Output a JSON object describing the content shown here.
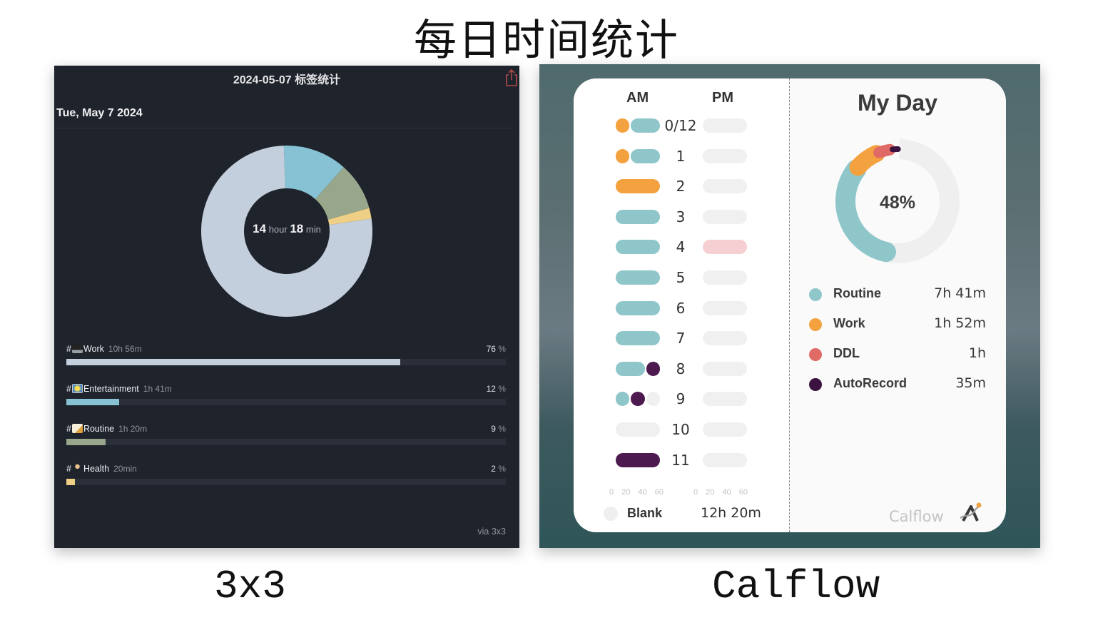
{
  "page_title": "每日时间统计",
  "captions": {
    "left": "3x3",
    "right": "Calflow"
  },
  "app_3x3": {
    "header_title": "2024-05-07 标签统计",
    "share_icon": "share-icon",
    "date_label": "Tue, May 7 2024",
    "total": {
      "hours": "14",
      "hour_unit": "hour",
      "minutes": "18",
      "minute_unit": "min"
    },
    "tags": [
      {
        "prefix": "#",
        "icon": "laptop-icon",
        "name": "Work",
        "duration": "10h 56m",
        "percent": "76",
        "percent_sign": "%",
        "fraction": 0.76,
        "color": "#c4cfdd"
      },
      {
        "prefix": "#",
        "icon": "sparkle-picture-icon",
        "name": "Entertainment",
        "duration": "1h 41m",
        "percent": "12",
        "percent_sign": "%",
        "fraction": 0.12,
        "color": "#86c2d3"
      },
      {
        "prefix": "#",
        "icon": "memo-icon",
        "name": "Routine",
        "duration": "1h 20m",
        "percent": "9",
        "percent_sign": "%",
        "fraction": 0.09,
        "color": "#98a68b"
      },
      {
        "prefix": "#",
        "icon": "runner-icon",
        "name": "Health",
        "duration": "20min",
        "percent": "2",
        "percent_sign": "%",
        "fraction": 0.02,
        "color": "#efcf86"
      }
    ],
    "footer": "via 3x3"
  },
  "app_calflow": {
    "am_label": "AM",
    "pm_label": "PM",
    "hours": [
      "0/12",
      "1",
      "2",
      "3",
      "4",
      "5",
      "6",
      "7",
      "8",
      "9",
      "10",
      "11"
    ],
    "am_segments": [
      [
        {
          "color": "#f4a13f",
          "minutes": 20
        },
        {
          "color": "#8fc6ca",
          "minutes": 40
        }
      ],
      [
        {
          "color": "#f4a13f",
          "minutes": 20
        },
        {
          "color": "#8fc6ca",
          "minutes": 40
        }
      ],
      [
        {
          "color": "#f4a13f",
          "minutes": 60
        }
      ],
      [
        {
          "color": "#8fc6ca",
          "minutes": 60
        }
      ],
      [
        {
          "color": "#8fc6ca",
          "minutes": 60
        }
      ],
      [
        {
          "color": "#8fc6ca",
          "minutes": 60
        }
      ],
      [
        {
          "color": "#8fc6ca",
          "minutes": 60
        }
      ],
      [
        {
          "color": "#8fc6ca",
          "minutes": 60
        }
      ],
      [
        {
          "color": "#8fc6ca",
          "minutes": 40
        },
        {
          "color": "#4d1a4f",
          "minutes": 20
        }
      ],
      [
        {
          "color": "#8fc6ca",
          "minutes": 20
        },
        {
          "color": "#4d1a4f",
          "minutes": 20
        },
        {
          "color": "#f0f0f0",
          "minutes": 20
        }
      ],
      [
        {
          "color": "#f0f0f0",
          "minutes": 60
        }
      ],
      [
        {
          "color": "#4d1a4f",
          "minutes": 60
        }
      ]
    ],
    "pm_segments": [
      [
        {
          "color": "#f0f0f0",
          "minutes": 60
        }
      ],
      [
        {
          "color": "#f0f0f0",
          "minutes": 60
        }
      ],
      [
        {
          "color": "#f0f0f0",
          "minutes": 60
        }
      ],
      [
        {
          "color": "#f0f0f0",
          "minutes": 60
        }
      ],
      [
        {
          "color": "#f6cfd3",
          "minutes": 60
        }
      ],
      [
        {
          "color": "#f0f0f0",
          "minutes": 60
        }
      ],
      [
        {
          "color": "#f0f0f0",
          "minutes": 60
        }
      ],
      [
        {
          "color": "#f0f0f0",
          "minutes": 60
        }
      ],
      [
        {
          "color": "#f0f0f0",
          "minutes": 60
        }
      ],
      [
        {
          "color": "#f0f0f0",
          "minutes": 60
        }
      ],
      [
        {
          "color": "#f0f0f0",
          "minutes": 60
        }
      ],
      [
        {
          "color": "#f0f0f0",
          "minutes": 60
        }
      ]
    ],
    "axis_ticks": "0 20 40 60",
    "blank": {
      "label": "Blank",
      "value": "12h 20m"
    },
    "title": "My Day",
    "percent": "48%",
    "categories": [
      {
        "name": "Routine",
        "value": "7h 41m",
        "minutes": 461,
        "color": "#8fc6ca"
      },
      {
        "name": "Work",
        "value": "1h 52m",
        "minutes": 112,
        "color": "#f4a13f"
      },
      {
        "name": "DDL",
        "value": "1h",
        "minutes": 60,
        "color": "#e06b66"
      },
      {
        "name": "AutoRecord",
        "value": "35m",
        "minutes": 35,
        "color": "#3b1240"
      }
    ],
    "brand": "Calflow"
  },
  "chart_data": [
    {
      "type": "pie",
      "title": "14 hour 18 min",
      "categories": [
        "Work",
        "Entertainment",
        "Routine",
        "Health"
      ],
      "values": [
        76,
        12,
        9,
        2
      ],
      "colors": [
        "#c4cfdd",
        "#86c2d3",
        "#98a68b",
        "#efcf86"
      ]
    },
    {
      "type": "pie",
      "title": "48%",
      "categories": [
        "Routine",
        "Work",
        "DDL",
        "AutoRecord",
        "Blank"
      ],
      "values": [
        461,
        112,
        60,
        35,
        740
      ],
      "colors": [
        "#8fc6ca",
        "#f4a13f",
        "#e06b66",
        "#3b1240",
        "#efefef"
      ]
    }
  ]
}
